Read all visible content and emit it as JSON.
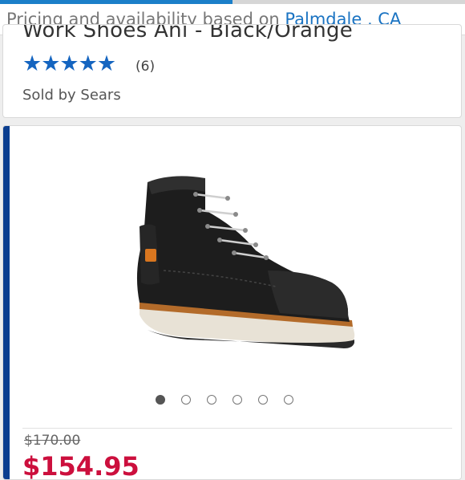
{
  "location": {
    "prefix": "Pricing and availability based on ",
    "city": "Palmdale , CA",
    "progress_fraction": 0.5
  },
  "product": {
    "title": "Work Shoes Ani - Black/Orange",
    "rating": {
      "stars": "★★★★★",
      "value": 5,
      "count": "(6)"
    },
    "sold_by": "Sold by Sears",
    "carousel": {
      "total": 6,
      "active_index": 0
    },
    "prices": {
      "original": "$170.00",
      "sale": "$154.95"
    }
  },
  "colors": {
    "link_blue": "#1a73c2",
    "star_blue": "#1565c0",
    "accent_navy": "#0b3e8f",
    "sale_red": "#cc0f3d"
  },
  "icons": [
    "star-icon",
    "boot-image"
  ]
}
